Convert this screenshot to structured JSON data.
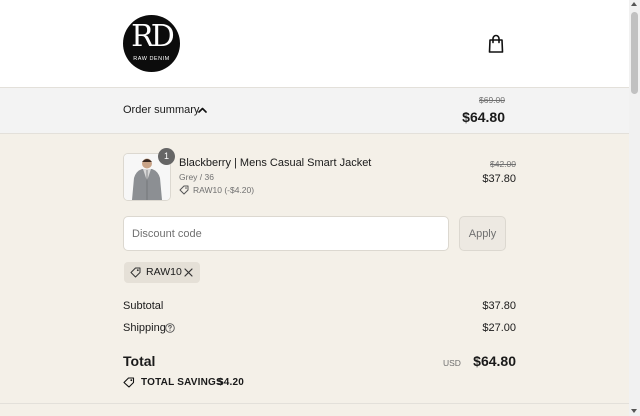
{
  "brand": {
    "monogram": "RD",
    "name": "RAW DENIM"
  },
  "header": {
    "cart_icon": "shopping-bag-icon"
  },
  "summary": {
    "label": "Order summary",
    "toggle_icon": "chevron-up-icon",
    "original_total": "$69.00",
    "total": "$64.80"
  },
  "line_item": {
    "quantity": "1",
    "name": "Blackberry | Mens Casual Smart Jacket",
    "variant": "Grey / 36",
    "discount": "RAW10 (-$4.20)",
    "original_price": "$42.00",
    "price": "$37.80"
  },
  "discount_form": {
    "placeholder": "Discount code",
    "value": "",
    "apply_label": "Apply"
  },
  "applied_code": {
    "code": "RAW10",
    "remove_icon": "close-icon"
  },
  "totals": {
    "subtotal_label": "Subtotal",
    "subtotal": "$37.80",
    "shipping_label": "Shipping",
    "shipping": "$27.00",
    "total_label": "Total",
    "currency": "USD",
    "total": "$64.80",
    "savings_label": "TOTAL SAVINGS",
    "savings": "$4.20"
  },
  "colors": {
    "page_bg": "#f4f0e8",
    "summary_bg": "#f3f3f3",
    "muted_text": "#707070",
    "chip_bg": "#e5e0d7",
    "badge_bg": "#666666"
  }
}
